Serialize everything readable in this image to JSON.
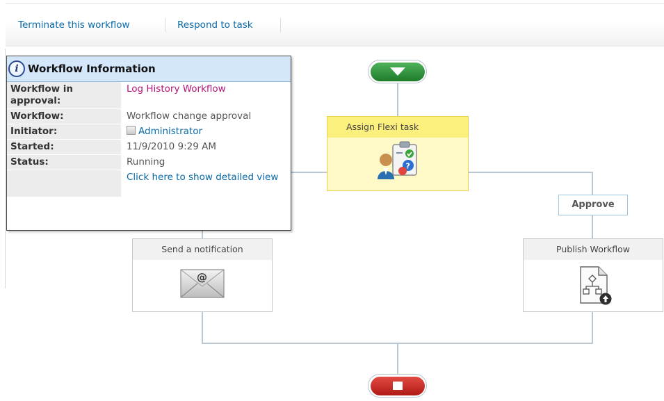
{
  "toolbar": {
    "terminate_label": "Terminate this workflow",
    "respond_label": "Respond to task"
  },
  "workflow": {
    "flexi_task_title": "Assign Flexi task",
    "notification_title": "Send a notification",
    "publish_title": "Publish Workflow",
    "approve_label": "Approve"
  },
  "info_panel": {
    "title": "Workflow Information",
    "rows": [
      {
        "label": "Workflow in approval:",
        "value": "Log History Workflow"
      },
      {
        "label": "Workflow:",
        "value": "Workflow change approval"
      },
      {
        "label": "Initiator:",
        "value": "Administrator"
      },
      {
        "label": "Started:",
        "value": "11/9/2010 9:29 AM"
      },
      {
        "label": "Status:",
        "value": "Running"
      },
      {
        "label": "",
        "value": "Click here to show detailed view"
      }
    ]
  },
  "icons": {
    "start": "start-arrow-icon",
    "end": "stop-icon",
    "info": "info-icon",
    "flexi_task": "user-task-clipboard-icon",
    "notification": "email-envelope-icon",
    "publish": "publish-workflow-document-icon",
    "initiator": "user-presence-icon"
  },
  "colors": {
    "link": "#0a6aa8",
    "accent_magenta": "#b0157a",
    "start_green": "#1d7a2a",
    "end_red": "#b01a15",
    "flexi_yellow": "#fbef7e",
    "info_header": "#d4e6fa"
  }
}
